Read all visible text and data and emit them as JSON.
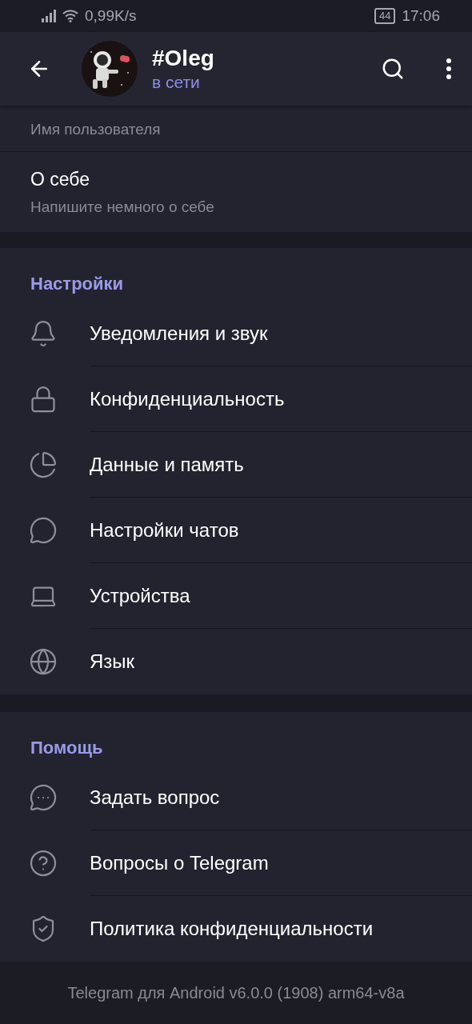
{
  "status_bar": {
    "speed": "0,99K/s",
    "battery": "44",
    "time": "17:06"
  },
  "header": {
    "title": "#Oleg",
    "status": "в сети"
  },
  "profile": {
    "username_caption": "Имя пользователя",
    "bio_label": "О себе",
    "bio_placeholder": "Напишите немного о себе"
  },
  "sections": [
    {
      "title": "Настройки",
      "items": [
        "Уведомления и звук",
        "Конфиденциальность",
        "Данные и память",
        "Настройки чатов",
        "Устройства",
        "Язык"
      ]
    },
    {
      "title": "Помощь",
      "items": [
        "Задать вопрос",
        "Вопросы о Telegram",
        "Политика конфиденциальности"
      ]
    }
  ],
  "footer": "Telegram для Android v6.0.0 (1908) arm64-v8a"
}
